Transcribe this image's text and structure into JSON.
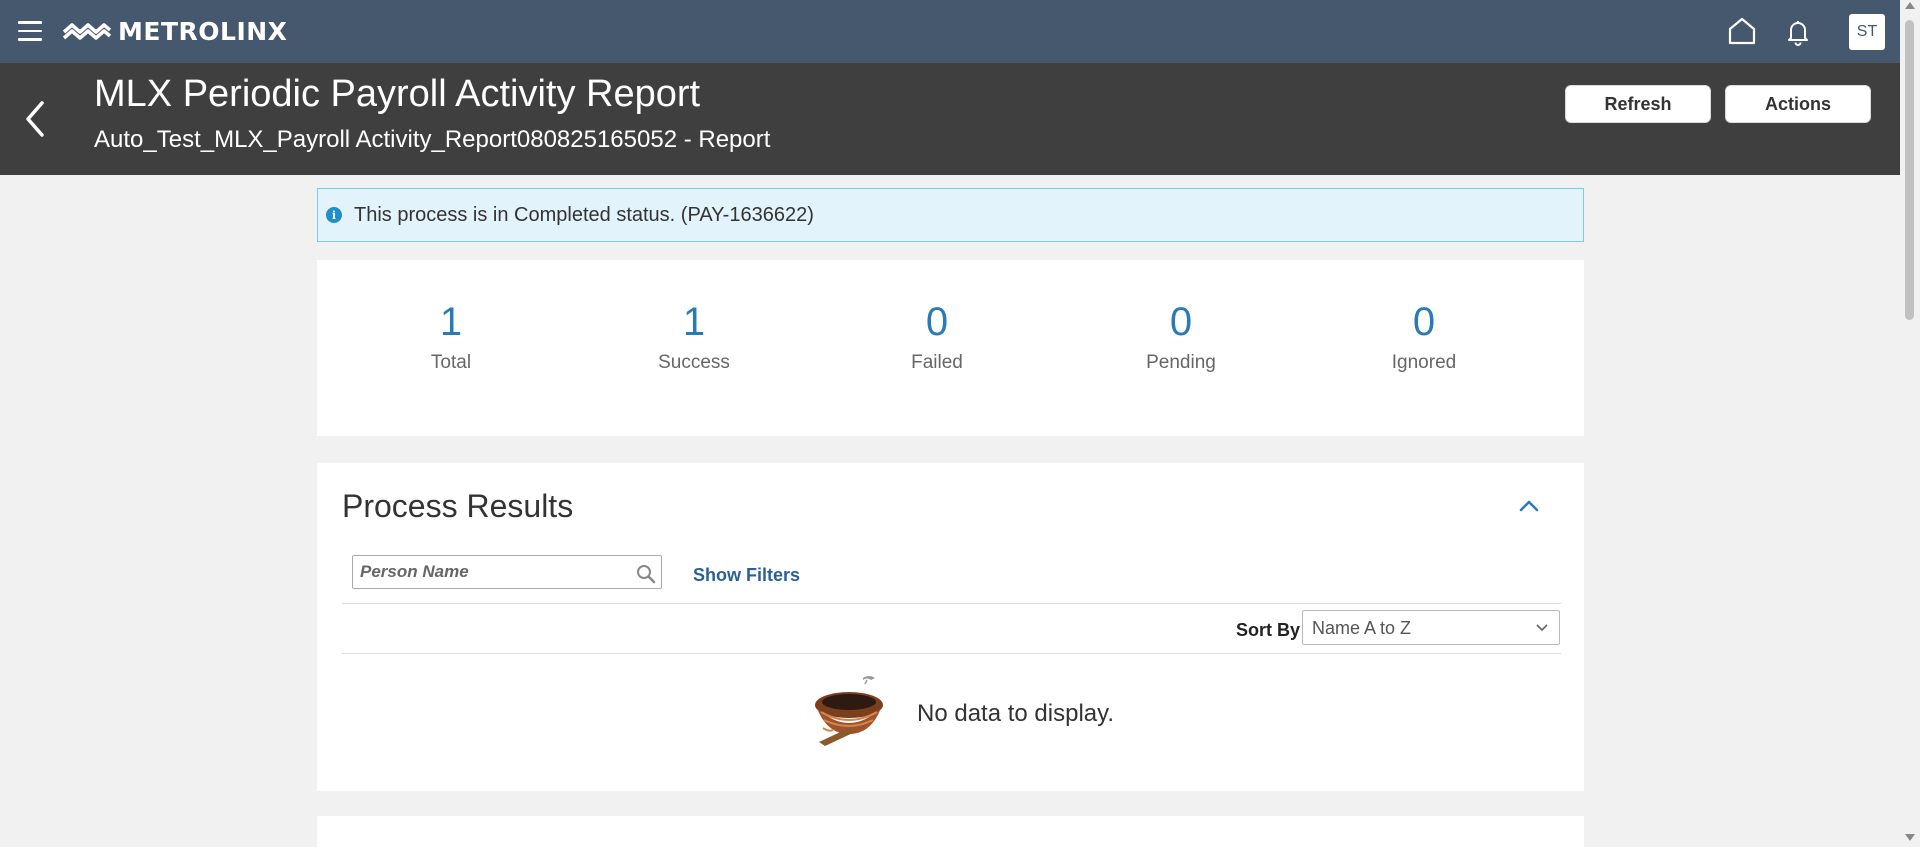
{
  "topbar": {
    "brand": "METROLINX",
    "avatar_initials": "ST",
    "icons": [
      "menu-icon",
      "metrolinx-logo-icon",
      "home-icon",
      "bell-icon"
    ],
    "background": "#46586e"
  },
  "header": {
    "title": "MLX Periodic Payroll Activity Report",
    "subtitle": "Auto_Test_MLX_Payroll Activity_Report080825165052 - Report",
    "refresh_label": "Refresh",
    "actions_label": "Actions",
    "background": "#3f3f3f"
  },
  "alert": {
    "text": "This process is in Completed status. (PAY-1636622)",
    "icon": "info-icon"
  },
  "summary": {
    "stats": [
      {
        "value": "1",
        "label": "Total"
      },
      {
        "value": "1",
        "label": "Success"
      },
      {
        "value": "0",
        "label": "Failed"
      },
      {
        "value": "0",
        "label": "Pending"
      },
      {
        "value": "0",
        "label": "Ignored"
      }
    ],
    "accent_color": "#2a7ab8"
  },
  "results": {
    "title": "Process Results",
    "search_placeholder": "Person Name",
    "show_filters_label": "Show Filters",
    "sort_label": "Sort By",
    "sort_value": "Name A to Z",
    "empty_message": "No data to display."
  }
}
